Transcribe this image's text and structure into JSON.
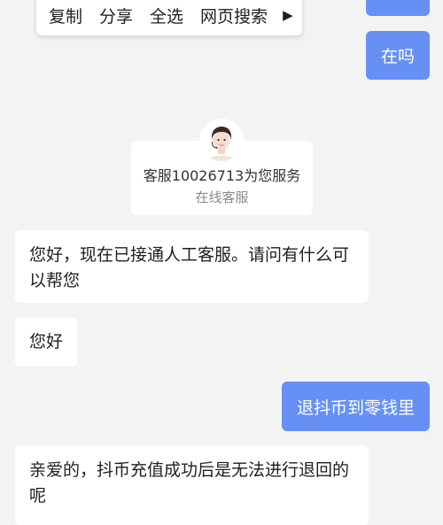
{
  "context_menu": {
    "items": [
      "复制",
      "分享",
      "全选",
      "网页搜索"
    ],
    "more_icon": "play-arrow-icon"
  },
  "messages": {
    "user_1": "在吗",
    "agent_card": {
      "name": "客服10026713为您服务",
      "role": "在线客服"
    },
    "agent_1": "您好，现在已接通人工客服。请问有什么可以帮您",
    "agent_2": "您好",
    "user_2": "退抖币到零钱里",
    "agent_3": "亲爱的，抖币充值成功后是无法进行退回的呢"
  },
  "colors": {
    "user_bubble": "#6690f4",
    "background": "#f3f3f3",
    "agent_bubble": "#ffffff"
  }
}
